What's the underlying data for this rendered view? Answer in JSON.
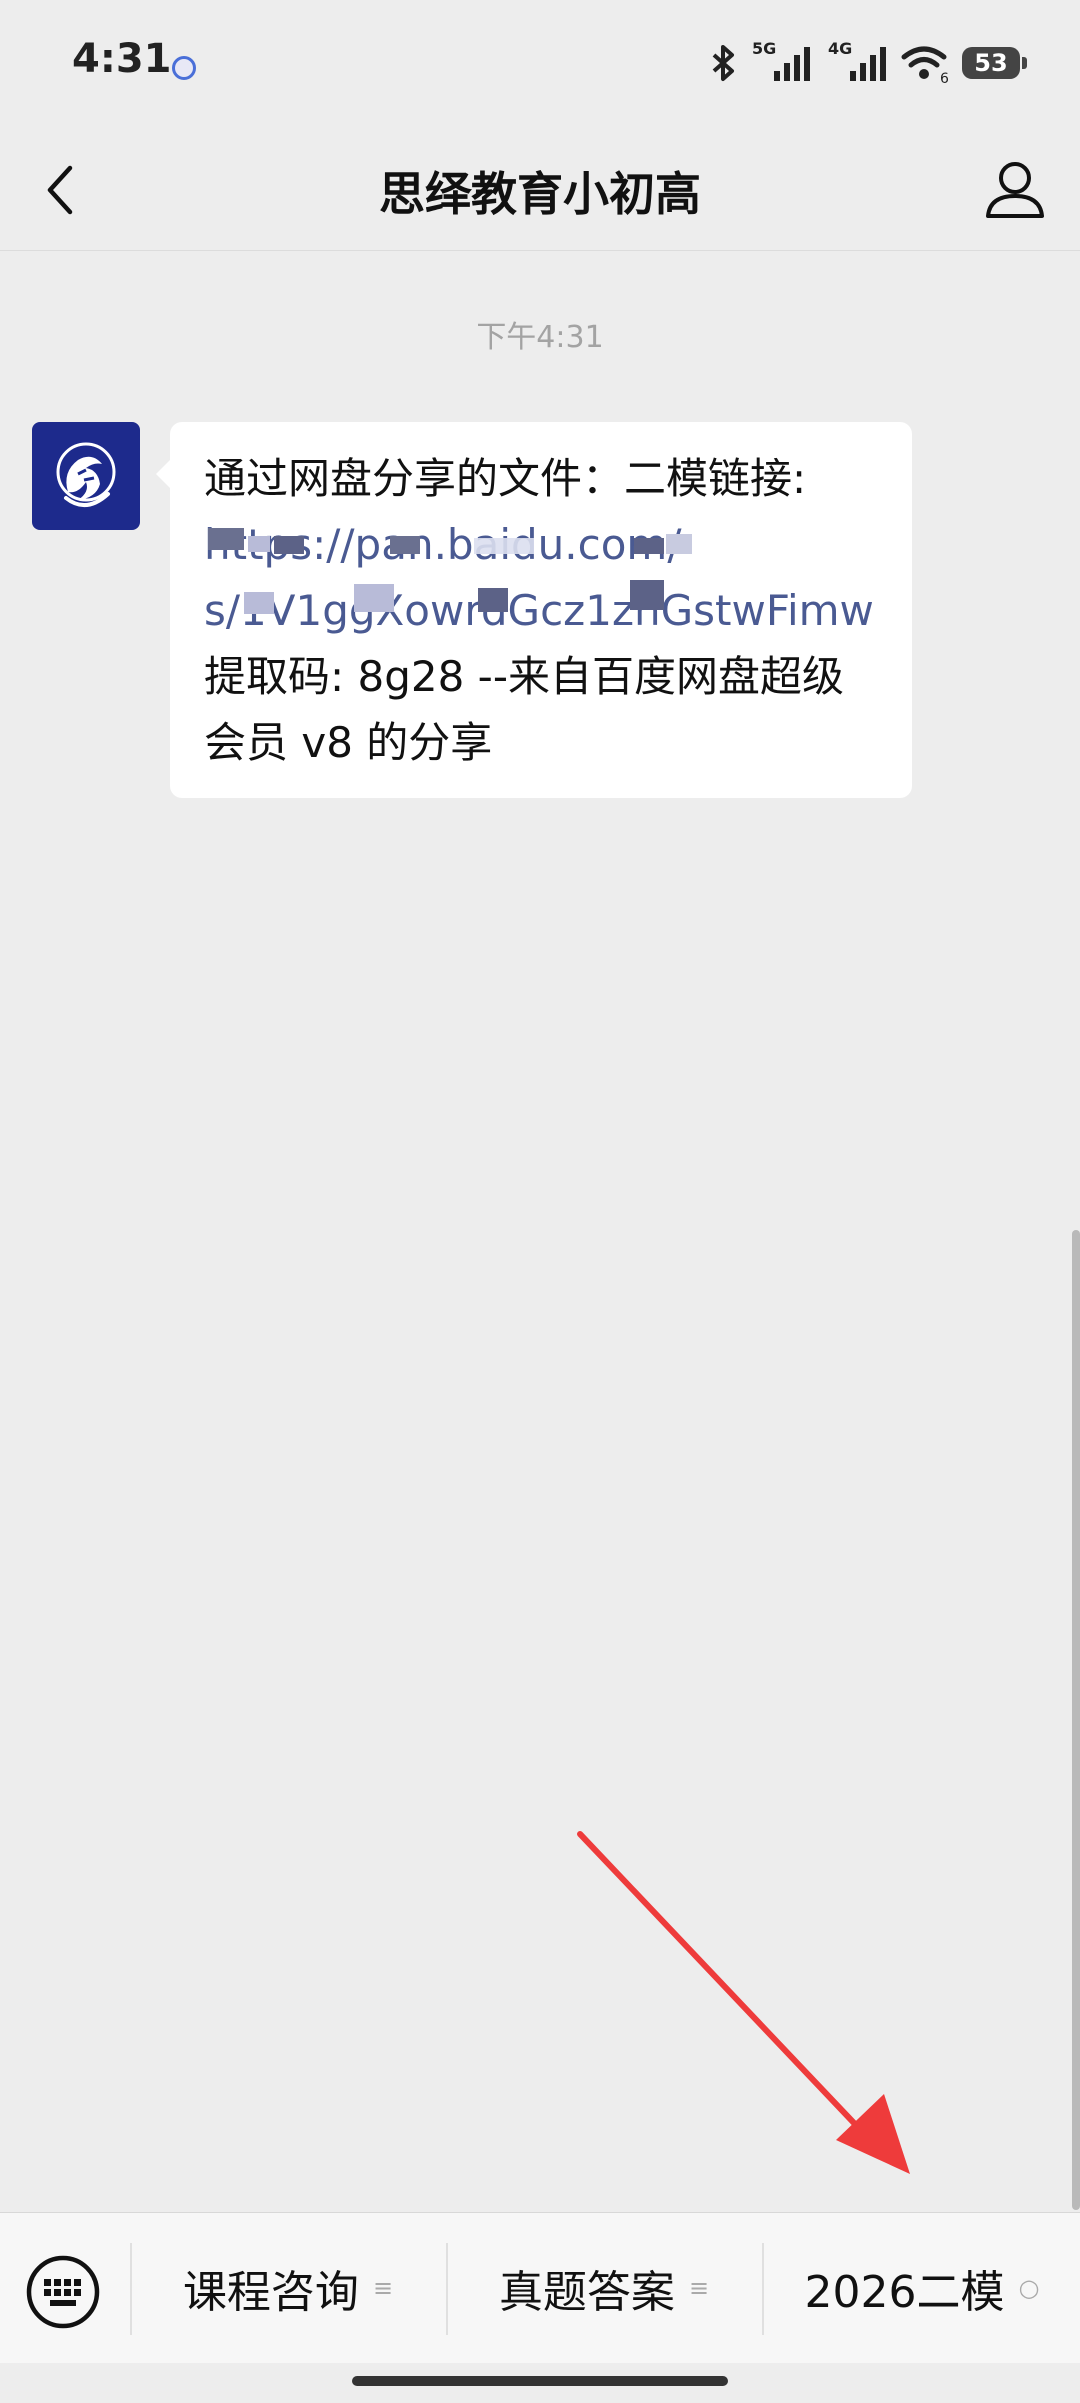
{
  "status_bar": {
    "time": "4:31",
    "net1": "5G",
    "net2": "4G",
    "wifi_sub": "6",
    "battery": "53",
    "icons": [
      "bluetooth-icon",
      "signal-icon",
      "wifi-icon",
      "battery-icon"
    ]
  },
  "nav": {
    "title": "思绎教育小初高",
    "back_icon": "chevron-left-icon",
    "profile_icon": "person-icon"
  },
  "chat": {
    "timestamp": "下午4:31",
    "message": {
      "line1": "通过网盘分享的文件：二模链接:",
      "link_line1": "https://pan.baidu.com/",
      "link_line2": "s/1V1ggXowrdGcz1zhGstwFimw",
      "line4": "提取码: 8g28 --来自百度网盘超级",
      "line5": "会员 v8 的分享"
    }
  },
  "menu": {
    "items": [
      {
        "label": "课程咨询",
        "suffix": "≡"
      },
      {
        "label": "真题答案",
        "suffix": "≡"
      },
      {
        "label": "2026二模",
        "suffix": "○"
      }
    ]
  },
  "colors": {
    "background": "#ededed",
    "bubble": "#ffffff",
    "link": "#4a5a92",
    "annotation": "#ee3b3b"
  }
}
